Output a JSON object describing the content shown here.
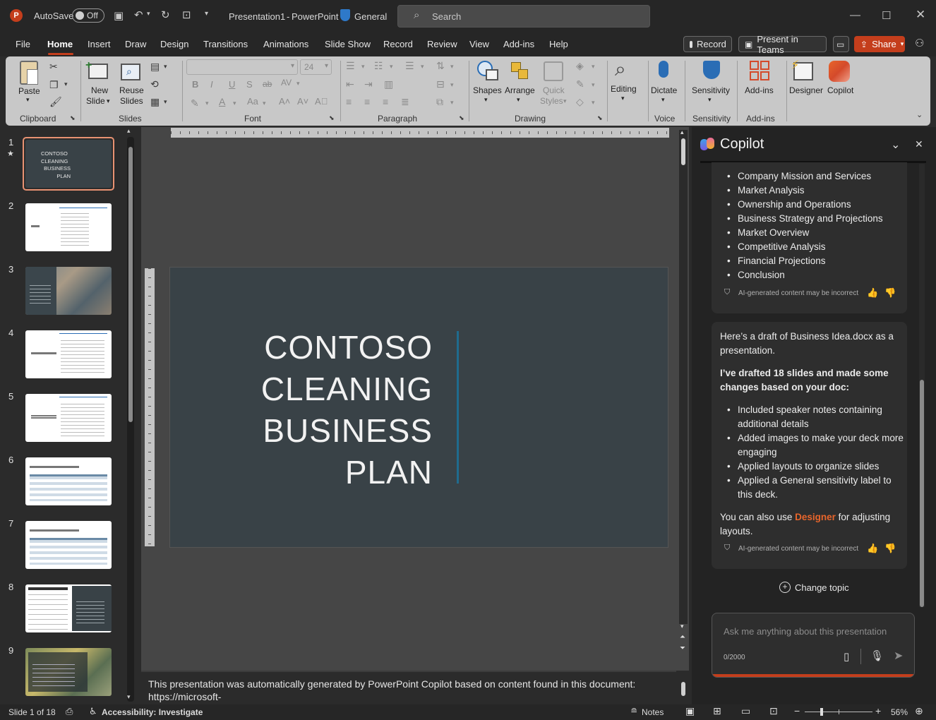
{
  "titlebar": {
    "autosave_label": "AutoSave",
    "autosave_state": "Off",
    "document_title": "Presentation1",
    "app_name": "PowerPoint",
    "sensitivity": "General",
    "search_placeholder": "Search"
  },
  "menu": {
    "items": [
      "File",
      "Home",
      "Insert",
      "Draw",
      "Design",
      "Transitions",
      "Animations",
      "Slide Show",
      "Record",
      "Review",
      "View",
      "Add-ins",
      "Help"
    ],
    "active": "Home",
    "record_button": "Record",
    "present_button": "Present in Teams",
    "share_button": "Share"
  },
  "ribbon": {
    "clipboard": {
      "paste": "Paste",
      "group": "Clipboard"
    },
    "slides": {
      "new_slide_1": "New",
      "new_slide_2": "Slide",
      "reuse_1": "Reuse",
      "reuse_2": "Slides",
      "group": "Slides"
    },
    "font": {
      "font_size": "24",
      "group": "Font"
    },
    "paragraph": {
      "group": "Paragraph"
    },
    "drawing": {
      "shapes": "Shapes",
      "arrange": "Arrange",
      "quick_1": "Quick",
      "quick_2": "Styles",
      "group": "Drawing"
    },
    "editing": {
      "label": "Editing"
    },
    "voice": {
      "dictate": "Dictate",
      "group": "Voice"
    },
    "sensitivity": {
      "label": "Sensitivity",
      "group": "Sensitivity"
    },
    "addins": {
      "label": "Add-ins",
      "group": "Add-ins"
    },
    "designer": "Designer",
    "copilot": "Copilot"
  },
  "thumbnails": {
    "numbers": [
      "1",
      "2",
      "3",
      "4",
      "5",
      "6",
      "7",
      "8",
      "9"
    ],
    "slide1_lines": [
      "CONTOSO",
      "CLEANING",
      "BUSINESS",
      "PLAN"
    ]
  },
  "slide": {
    "title_lines": [
      "CONTOSO",
      "CLEANING",
      "BUSINESS",
      "PLAN"
    ]
  },
  "notes": {
    "text": "This presentation was automatically generated by PowerPoint Copilot based on content found in this document: https://microsoft-"
  },
  "copilot": {
    "title": "Copilot",
    "outline_items": [
      "Company Mission and Services",
      "Market Analysis",
      "Ownership and Operations",
      "Business Strategy and Projections",
      "Market Overview",
      "Competitive Analysis",
      "Financial Projections",
      "Conclusion"
    ],
    "ai_note": "AI-generated content may be incorrect",
    "draft_intro": "Here’s a draft of Business Idea.docx as a presentation.",
    "draft_bold": "I’ve drafted 18 slides and made some changes based on your doc:",
    "changes": [
      "Included speaker notes containing additional details",
      "Added images to make your deck more engaging",
      "Applied layouts to organize slides",
      "Applied a General sensitivity label to this deck."
    ],
    "designer_pre": "You can also use ",
    "designer_link": "Designer",
    "designer_post": " for adjusting layouts.",
    "change_topic": "Change topic",
    "input_placeholder": "Ask me anything about this presentation",
    "char_count": "0/2000"
  },
  "status": {
    "slide_counter": "Slide 1 of 18",
    "accessibility": "Accessibility: Investigate",
    "notes": "Notes",
    "zoom": "56%"
  },
  "colors": {
    "accent": "#c43e1c",
    "slide_bg": "#394247",
    "designer_link": "#e8652b",
    "slide_rule": "#1f6b8e"
  }
}
